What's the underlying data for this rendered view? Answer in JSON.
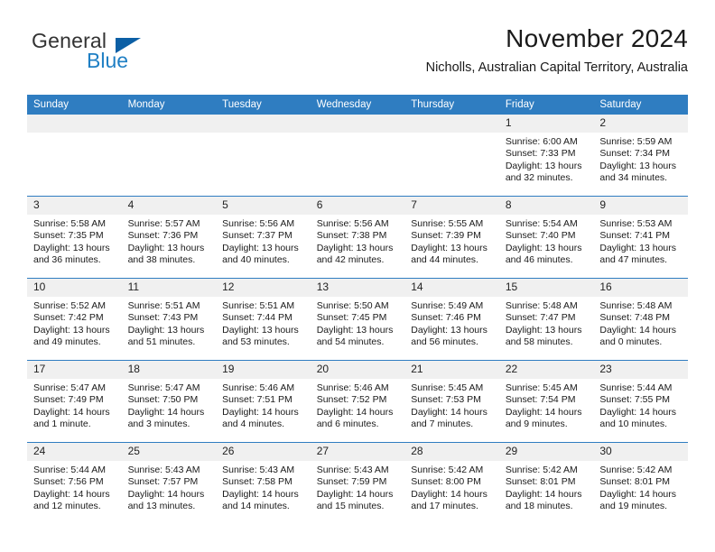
{
  "brand": {
    "name_part1": "General",
    "name_part2": "Blue",
    "flag_icon": "triangle-flag-icon",
    "accent_color": "#1f7fc4",
    "flag_color": "#0c5fa5"
  },
  "header": {
    "month_title": "November 2024",
    "location": "Nicholls, Australian Capital Territory, Australia"
  },
  "calendar": {
    "header_color": "#2f7dc1",
    "daynum_bg": "#f0f0f0",
    "weekday_headers": [
      "Sunday",
      "Monday",
      "Tuesday",
      "Wednesday",
      "Thursday",
      "Friday",
      "Saturday"
    ],
    "weeks": [
      [
        {
          "day": "",
          "sunrise": "",
          "sunset": "",
          "daylight": "",
          "blank": true
        },
        {
          "day": "",
          "sunrise": "",
          "sunset": "",
          "daylight": "",
          "blank": true
        },
        {
          "day": "",
          "sunrise": "",
          "sunset": "",
          "daylight": "",
          "blank": true
        },
        {
          "day": "",
          "sunrise": "",
          "sunset": "",
          "daylight": "",
          "blank": true
        },
        {
          "day": "",
          "sunrise": "",
          "sunset": "",
          "daylight": "",
          "blank": true
        },
        {
          "day": "1",
          "sunrise": "Sunrise: 6:00 AM",
          "sunset": "Sunset: 7:33 PM",
          "daylight": "Daylight: 13 hours and 32 minutes.",
          "blank": false
        },
        {
          "day": "2",
          "sunrise": "Sunrise: 5:59 AM",
          "sunset": "Sunset: 7:34 PM",
          "daylight": "Daylight: 13 hours and 34 minutes.",
          "blank": false
        }
      ],
      [
        {
          "day": "3",
          "sunrise": "Sunrise: 5:58 AM",
          "sunset": "Sunset: 7:35 PM",
          "daylight": "Daylight: 13 hours and 36 minutes.",
          "blank": false
        },
        {
          "day": "4",
          "sunrise": "Sunrise: 5:57 AM",
          "sunset": "Sunset: 7:36 PM",
          "daylight": "Daylight: 13 hours and 38 minutes.",
          "blank": false
        },
        {
          "day": "5",
          "sunrise": "Sunrise: 5:56 AM",
          "sunset": "Sunset: 7:37 PM",
          "daylight": "Daylight: 13 hours and 40 minutes.",
          "blank": false
        },
        {
          "day": "6",
          "sunrise": "Sunrise: 5:56 AM",
          "sunset": "Sunset: 7:38 PM",
          "daylight": "Daylight: 13 hours and 42 minutes.",
          "blank": false
        },
        {
          "day": "7",
          "sunrise": "Sunrise: 5:55 AM",
          "sunset": "Sunset: 7:39 PM",
          "daylight": "Daylight: 13 hours and 44 minutes.",
          "blank": false
        },
        {
          "day": "8",
          "sunrise": "Sunrise: 5:54 AM",
          "sunset": "Sunset: 7:40 PM",
          "daylight": "Daylight: 13 hours and 46 minutes.",
          "blank": false
        },
        {
          "day": "9",
          "sunrise": "Sunrise: 5:53 AM",
          "sunset": "Sunset: 7:41 PM",
          "daylight": "Daylight: 13 hours and 47 minutes.",
          "blank": false
        }
      ],
      [
        {
          "day": "10",
          "sunrise": "Sunrise: 5:52 AM",
          "sunset": "Sunset: 7:42 PM",
          "daylight": "Daylight: 13 hours and 49 minutes.",
          "blank": false
        },
        {
          "day": "11",
          "sunrise": "Sunrise: 5:51 AM",
          "sunset": "Sunset: 7:43 PM",
          "daylight": "Daylight: 13 hours and 51 minutes.",
          "blank": false
        },
        {
          "day": "12",
          "sunrise": "Sunrise: 5:51 AM",
          "sunset": "Sunset: 7:44 PM",
          "daylight": "Daylight: 13 hours and 53 minutes.",
          "blank": false
        },
        {
          "day": "13",
          "sunrise": "Sunrise: 5:50 AM",
          "sunset": "Sunset: 7:45 PM",
          "daylight": "Daylight: 13 hours and 54 minutes.",
          "blank": false
        },
        {
          "day": "14",
          "sunrise": "Sunrise: 5:49 AM",
          "sunset": "Sunset: 7:46 PM",
          "daylight": "Daylight: 13 hours and 56 minutes.",
          "blank": false
        },
        {
          "day": "15",
          "sunrise": "Sunrise: 5:48 AM",
          "sunset": "Sunset: 7:47 PM",
          "daylight": "Daylight: 13 hours and 58 minutes.",
          "blank": false
        },
        {
          "day": "16",
          "sunrise": "Sunrise: 5:48 AM",
          "sunset": "Sunset: 7:48 PM",
          "daylight": "Daylight: 14 hours and 0 minutes.",
          "blank": false
        }
      ],
      [
        {
          "day": "17",
          "sunrise": "Sunrise: 5:47 AM",
          "sunset": "Sunset: 7:49 PM",
          "daylight": "Daylight: 14 hours and 1 minute.",
          "blank": false
        },
        {
          "day": "18",
          "sunrise": "Sunrise: 5:47 AM",
          "sunset": "Sunset: 7:50 PM",
          "daylight": "Daylight: 14 hours and 3 minutes.",
          "blank": false
        },
        {
          "day": "19",
          "sunrise": "Sunrise: 5:46 AM",
          "sunset": "Sunset: 7:51 PM",
          "daylight": "Daylight: 14 hours and 4 minutes.",
          "blank": false
        },
        {
          "day": "20",
          "sunrise": "Sunrise: 5:46 AM",
          "sunset": "Sunset: 7:52 PM",
          "daylight": "Daylight: 14 hours and 6 minutes.",
          "blank": false
        },
        {
          "day": "21",
          "sunrise": "Sunrise: 5:45 AM",
          "sunset": "Sunset: 7:53 PM",
          "daylight": "Daylight: 14 hours and 7 minutes.",
          "blank": false
        },
        {
          "day": "22",
          "sunrise": "Sunrise: 5:45 AM",
          "sunset": "Sunset: 7:54 PM",
          "daylight": "Daylight: 14 hours and 9 minutes.",
          "blank": false
        },
        {
          "day": "23",
          "sunrise": "Sunrise: 5:44 AM",
          "sunset": "Sunset: 7:55 PM",
          "daylight": "Daylight: 14 hours and 10 minutes.",
          "blank": false
        }
      ],
      [
        {
          "day": "24",
          "sunrise": "Sunrise: 5:44 AM",
          "sunset": "Sunset: 7:56 PM",
          "daylight": "Daylight: 14 hours and 12 minutes.",
          "blank": false
        },
        {
          "day": "25",
          "sunrise": "Sunrise: 5:43 AM",
          "sunset": "Sunset: 7:57 PM",
          "daylight": "Daylight: 14 hours and 13 minutes.",
          "blank": false
        },
        {
          "day": "26",
          "sunrise": "Sunrise: 5:43 AM",
          "sunset": "Sunset: 7:58 PM",
          "daylight": "Daylight: 14 hours and 14 minutes.",
          "blank": false
        },
        {
          "day": "27",
          "sunrise": "Sunrise: 5:43 AM",
          "sunset": "Sunset: 7:59 PM",
          "daylight": "Daylight: 14 hours and 15 minutes.",
          "blank": false
        },
        {
          "day": "28",
          "sunrise": "Sunrise: 5:42 AM",
          "sunset": "Sunset: 8:00 PM",
          "daylight": "Daylight: 14 hours and 17 minutes.",
          "blank": false
        },
        {
          "day": "29",
          "sunrise": "Sunrise: 5:42 AM",
          "sunset": "Sunset: 8:01 PM",
          "daylight": "Daylight: 14 hours and 18 minutes.",
          "blank": false
        },
        {
          "day": "30",
          "sunrise": "Sunrise: 5:42 AM",
          "sunset": "Sunset: 8:01 PM",
          "daylight": "Daylight: 14 hours and 19 minutes.",
          "blank": false
        }
      ]
    ]
  }
}
